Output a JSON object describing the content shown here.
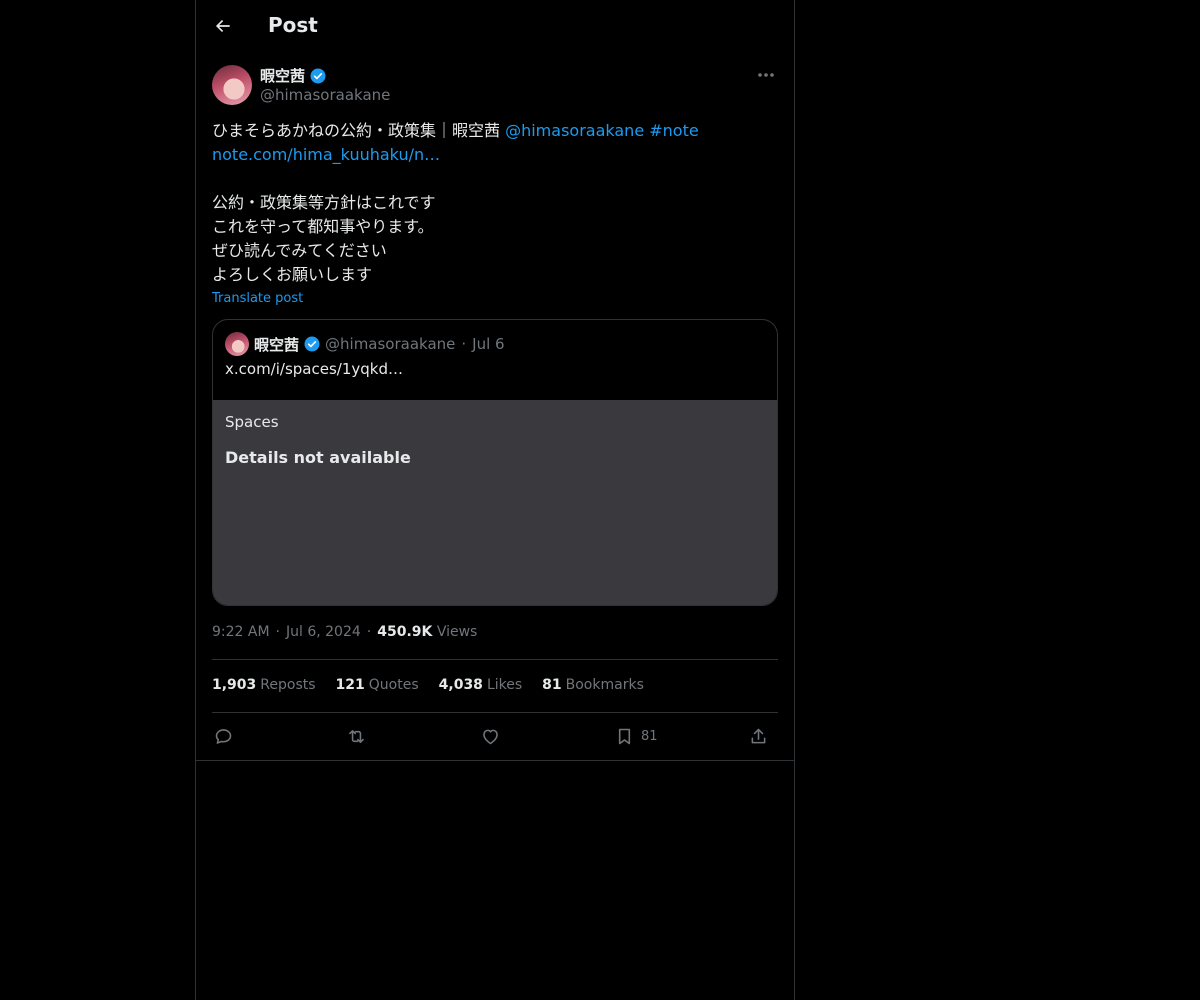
{
  "header": {
    "title": "Post"
  },
  "author": {
    "display_name": "暇空茜",
    "handle": "@himasoraakane"
  },
  "tweet": {
    "line1_text": "ひまそらあかねの公約・政策集｜暇空茜 ",
    "line1_mention": "@himasoraakane",
    "line1_hashtag": "#note",
    "line2_link": "note.com/hima_kuuhaku/n…",
    "body_lines": [
      "公約・政策集等方針はこれです",
      "これを守って都知事やります。",
      "ぜひ読んでみてください",
      "よろしくお願いします"
    ],
    "translate_label": "Translate post"
  },
  "quote": {
    "display_name": "暇空茜",
    "handle": "@himasoraakane",
    "separator": "·",
    "date": "Jul 6",
    "text": "x.com/i/spaces/1yqkd…",
    "card_label": "Spaces",
    "card_status": "Details not available"
  },
  "meta": {
    "time": "9:22 AM",
    "separator": "·",
    "date": "Jul 6, 2024",
    "views_count": "450.9K",
    "views_label": "Views"
  },
  "stats": {
    "reposts_count": "1,903",
    "reposts_label": "Reposts",
    "quotes_count": "121",
    "quotes_label": "Quotes",
    "likes_count": "4,038",
    "likes_label": "Likes",
    "bookmarks_count": "81",
    "bookmarks_label": "Bookmarks"
  },
  "actions": {
    "bookmark_count": "81"
  },
  "icons": {
    "back": "arrow-left-icon",
    "verified": "verified-badge-icon",
    "more": "more-horizontal-icon",
    "reply": "reply-icon",
    "repost": "repost-icon",
    "like": "heart-icon",
    "bookmark": "bookmark-icon",
    "share": "share-icon"
  },
  "colors": {
    "background": "#000000",
    "text": "#e7e9ea",
    "muted": "#71767b",
    "accent": "#1d9bf0",
    "border": "#2f3336",
    "spaces_card": "#3a393e"
  }
}
